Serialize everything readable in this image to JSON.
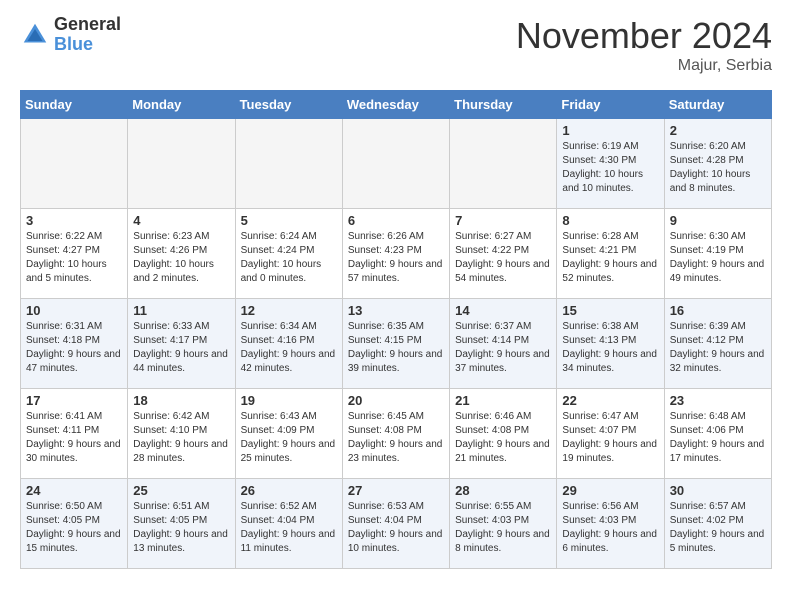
{
  "header": {
    "logo_general": "General",
    "logo_blue": "Blue",
    "month_title": "November 2024",
    "location": "Majur, Serbia"
  },
  "days_of_week": [
    "Sunday",
    "Monday",
    "Tuesday",
    "Wednesday",
    "Thursday",
    "Friday",
    "Saturday"
  ],
  "weeks": [
    [
      {
        "day": "",
        "info": "",
        "empty": true
      },
      {
        "day": "",
        "info": "",
        "empty": true
      },
      {
        "day": "",
        "info": "",
        "empty": true
      },
      {
        "day": "",
        "info": "",
        "empty": true
      },
      {
        "day": "",
        "info": "",
        "empty": true
      },
      {
        "day": "1",
        "info": "Sunrise: 6:19 AM\nSunset: 4:30 PM\nDaylight: 10 hours and 10 minutes."
      },
      {
        "day": "2",
        "info": "Sunrise: 6:20 AM\nSunset: 4:28 PM\nDaylight: 10 hours and 8 minutes."
      }
    ],
    [
      {
        "day": "3",
        "info": "Sunrise: 6:22 AM\nSunset: 4:27 PM\nDaylight: 10 hours and 5 minutes."
      },
      {
        "day": "4",
        "info": "Sunrise: 6:23 AM\nSunset: 4:26 PM\nDaylight: 10 hours and 2 minutes."
      },
      {
        "day": "5",
        "info": "Sunrise: 6:24 AM\nSunset: 4:24 PM\nDaylight: 10 hours and 0 minutes."
      },
      {
        "day": "6",
        "info": "Sunrise: 6:26 AM\nSunset: 4:23 PM\nDaylight: 9 hours and 57 minutes."
      },
      {
        "day": "7",
        "info": "Sunrise: 6:27 AM\nSunset: 4:22 PM\nDaylight: 9 hours and 54 minutes."
      },
      {
        "day": "8",
        "info": "Sunrise: 6:28 AM\nSunset: 4:21 PM\nDaylight: 9 hours and 52 minutes."
      },
      {
        "day": "9",
        "info": "Sunrise: 6:30 AM\nSunset: 4:19 PM\nDaylight: 9 hours and 49 minutes."
      }
    ],
    [
      {
        "day": "10",
        "info": "Sunrise: 6:31 AM\nSunset: 4:18 PM\nDaylight: 9 hours and 47 minutes."
      },
      {
        "day": "11",
        "info": "Sunrise: 6:33 AM\nSunset: 4:17 PM\nDaylight: 9 hours and 44 minutes."
      },
      {
        "day": "12",
        "info": "Sunrise: 6:34 AM\nSunset: 4:16 PM\nDaylight: 9 hours and 42 minutes."
      },
      {
        "day": "13",
        "info": "Sunrise: 6:35 AM\nSunset: 4:15 PM\nDaylight: 9 hours and 39 minutes."
      },
      {
        "day": "14",
        "info": "Sunrise: 6:37 AM\nSunset: 4:14 PM\nDaylight: 9 hours and 37 minutes."
      },
      {
        "day": "15",
        "info": "Sunrise: 6:38 AM\nSunset: 4:13 PM\nDaylight: 9 hours and 34 minutes."
      },
      {
        "day": "16",
        "info": "Sunrise: 6:39 AM\nSunset: 4:12 PM\nDaylight: 9 hours and 32 minutes."
      }
    ],
    [
      {
        "day": "17",
        "info": "Sunrise: 6:41 AM\nSunset: 4:11 PM\nDaylight: 9 hours and 30 minutes."
      },
      {
        "day": "18",
        "info": "Sunrise: 6:42 AM\nSunset: 4:10 PM\nDaylight: 9 hours and 28 minutes."
      },
      {
        "day": "19",
        "info": "Sunrise: 6:43 AM\nSunset: 4:09 PM\nDaylight: 9 hours and 25 minutes."
      },
      {
        "day": "20",
        "info": "Sunrise: 6:45 AM\nSunset: 4:08 PM\nDaylight: 9 hours and 23 minutes."
      },
      {
        "day": "21",
        "info": "Sunrise: 6:46 AM\nSunset: 4:08 PM\nDaylight: 9 hours and 21 minutes."
      },
      {
        "day": "22",
        "info": "Sunrise: 6:47 AM\nSunset: 4:07 PM\nDaylight: 9 hours and 19 minutes."
      },
      {
        "day": "23",
        "info": "Sunrise: 6:48 AM\nSunset: 4:06 PM\nDaylight: 9 hours and 17 minutes."
      }
    ],
    [
      {
        "day": "24",
        "info": "Sunrise: 6:50 AM\nSunset: 4:05 PM\nDaylight: 9 hours and 15 minutes."
      },
      {
        "day": "25",
        "info": "Sunrise: 6:51 AM\nSunset: 4:05 PM\nDaylight: 9 hours and 13 minutes."
      },
      {
        "day": "26",
        "info": "Sunrise: 6:52 AM\nSunset: 4:04 PM\nDaylight: 9 hours and 11 minutes."
      },
      {
        "day": "27",
        "info": "Sunrise: 6:53 AM\nSunset: 4:04 PM\nDaylight: 9 hours and 10 minutes."
      },
      {
        "day": "28",
        "info": "Sunrise: 6:55 AM\nSunset: 4:03 PM\nDaylight: 9 hours and 8 minutes."
      },
      {
        "day": "29",
        "info": "Sunrise: 6:56 AM\nSunset: 4:03 PM\nDaylight: 9 hours and 6 minutes."
      },
      {
        "day": "30",
        "info": "Sunrise: 6:57 AM\nSunset: 4:02 PM\nDaylight: 9 hours and 5 minutes."
      }
    ]
  ]
}
